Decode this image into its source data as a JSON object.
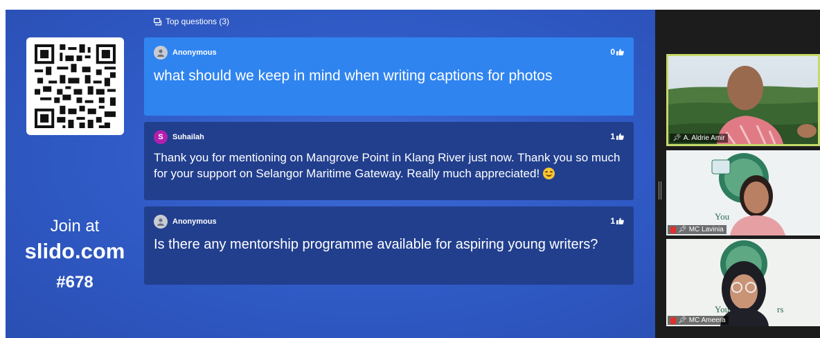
{
  "slido": {
    "header": "Top questions (3)",
    "join_at": "Join at",
    "join_url": "slido.com",
    "join_code": "#678",
    "questions": [
      {
        "author": "Anonymous",
        "author_initial": "",
        "likes": "0",
        "text": "what should we keep in mind when writing captions for photos"
      },
      {
        "author": "Suhailah",
        "author_initial": "S",
        "likes": "1",
        "text": "Thank you for mentioning on Mangrove Point in Klang River just now. Thank you so much for your support on Selangor Maritime Gateway. Really much appreciated!"
      },
      {
        "author": "Anonymous",
        "author_initial": "",
        "likes": "1",
        "text": "Is there any mentorship programme available for aspiring young writers?"
      }
    ]
  },
  "participants": [
    {
      "name": "A. Aldrie Amir",
      "pinned": true,
      "muted": false
    },
    {
      "name": "MC Lavinia",
      "pinned": true,
      "muted": true
    },
    {
      "name": "MC Ameera",
      "pinned": true,
      "muted": true
    }
  ],
  "colors": {
    "stage_blue": "#2f59c4",
    "active_card": "#2f84f0",
    "card": "#223f8e",
    "speaker_highlight": "#c6d96a"
  }
}
